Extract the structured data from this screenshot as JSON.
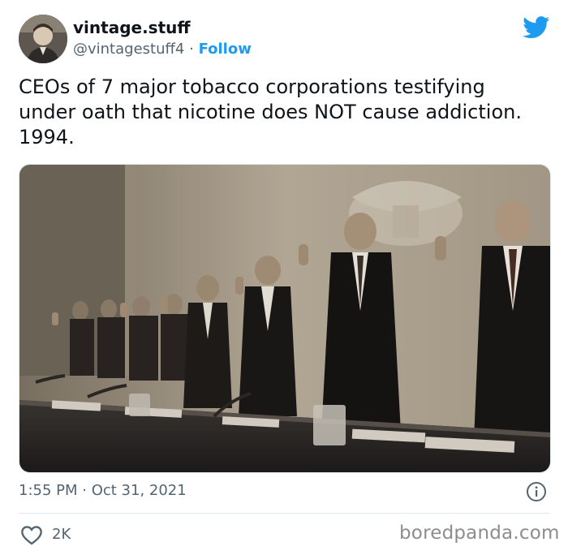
{
  "author": {
    "display_name": "vintage.stuff",
    "handle": "@vintagestuff4",
    "separator": "·",
    "follow_label": "Follow",
    "avatar_icon": "person-avatar"
  },
  "platform_icon": "twitter-bird-icon",
  "tweet": {
    "text": "CEOs of 7 major tobacco corporations testifying under oath that nicotine does NOT cause addiction. 1994.",
    "timestamp": "1:55 PM · Oct 31, 2021",
    "likes": "2K"
  },
  "watermark": "boredpanda.com",
  "colors": {
    "accent": "#1d9bf0",
    "text": "#0f1419",
    "muted": "#536471",
    "divider": "#e1e8ed"
  }
}
